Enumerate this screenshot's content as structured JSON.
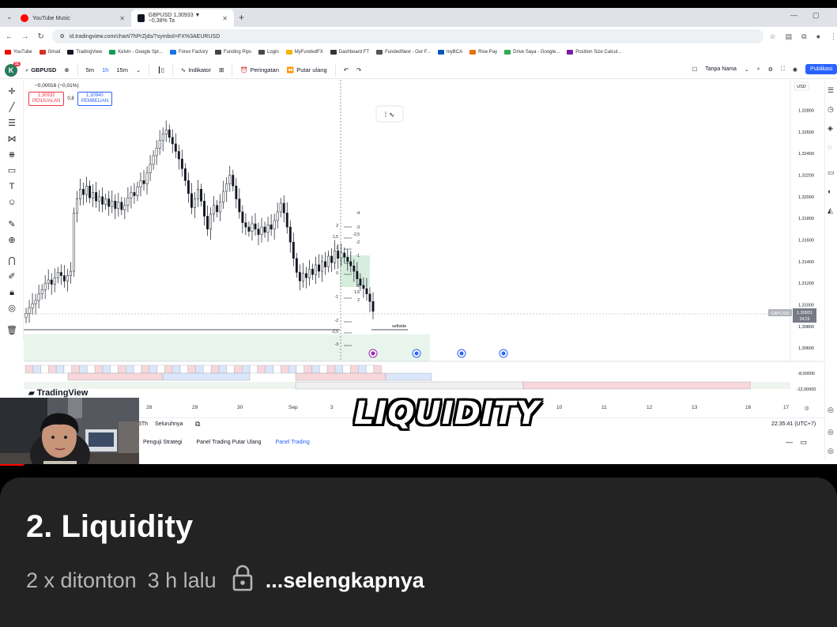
{
  "browser": {
    "tabs": [
      {
        "label": "YouTube Music",
        "color": "#ff0000"
      },
      {
        "label": "GBPUSD 1,30933 ▼ −0,38% Ta",
        "color": "#131722"
      }
    ],
    "url": "id.tradingview.com/chart/7hPrZjds/?symbol=FX%3AEURUSD",
    "bookmarks": [
      "YouTube",
      "Gmail",
      "TradingView",
      "Kelvin - Google Spr...",
      "Forex Factory",
      "Funding Pips",
      "Login",
      "MyFundedFX",
      "Dashboard FT",
      "FundedNext - Our F...",
      "myBCA",
      "Rise Pay",
      "Drive Saya - Google...",
      "Position Size Calcul..."
    ]
  },
  "tv_toolbar": {
    "logo_letter": "K",
    "logo_badge": "11",
    "symbol": "GBPUSD",
    "timeframes": [
      "5m",
      "1h",
      "15m"
    ],
    "indicator_label": "Indikator",
    "alert_label": "Peringatan",
    "replay_label": "Putar ulang",
    "layout_name": "Tanpa Nama",
    "publish_label": "Publikasi"
  },
  "ticker": {
    "change": "−0,00016 (−0,01%)",
    "sell_price": "1,30932",
    "sell_label": "PENJUALAN",
    "spread": "0,8",
    "buy_price": "1,30940",
    "buy_label": "PEMBELIAN"
  },
  "chart_data": {
    "type": "candlestick",
    "symbol": "GBPUSD",
    "currency": "USD",
    "y_ticks": [
      "1,32800",
      "1,32600",
      "1,32400",
      "1,32200",
      "1,32000",
      "1,31800",
      "1,31600",
      "1,31400",
      "1,31200",
      "1,31000",
      "1,30800",
      "1,30600"
    ],
    "y_values": [
      1.328,
      1.326,
      1.324,
      1.322,
      1.32,
      1.318,
      1.316,
      1.314,
      1.312,
      1.31,
      1.308,
      1.306
    ],
    "ylim": [
      1.3052,
      1.3298
    ],
    "current_price_label": "GBPUSD",
    "current_price": "1,30931",
    "countdown": "24:19",
    "annotation": "sellside",
    "fib_labels_left": [
      "2",
      "1,5",
      "1",
      "0",
      "-1",
      "-2",
      "-2,5",
      "-3"
    ],
    "fib_labels_right": [
      "-4",
      "-3",
      "-2,5",
      "-2",
      "-1",
      "1",
      "1,5",
      "2"
    ],
    "indicator_ticks": [
      "-8,00000",
      "-12,00000"
    ],
    "x_dates": [
      "28",
      "29",
      "30",
      "Sep",
      "3",
      "9",
      "10",
      "11",
      "12",
      "13",
      "16",
      "17"
    ],
    "candles": [
      1.3092,
      1.3097,
      1.3101,
      1.3104,
      1.311,
      1.3114,
      1.312,
      1.3123,
      1.3119,
      1.3125,
      1.313,
      1.3127,
      1.3122,
      1.3127,
      1.3131,
      1.3185,
      1.3198,
      1.3207,
      1.3202,
      1.321,
      1.3199,
      1.3204,
      1.3196,
      1.32,
      1.3193,
      1.3198,
      1.3191,
      1.3196,
      1.3189,
      1.3195,
      1.3188,
      1.3192,
      1.3199,
      1.3204,
      1.3201,
      1.3209,
      1.3215,
      1.3212,
      1.3222,
      1.323,
      1.3238,
      1.3245,
      1.3252,
      1.3258,
      1.3262,
      1.3255,
      1.3249,
      1.3242,
      1.3235,
      1.3226,
      1.3215,
      1.3203,
      1.319,
      1.3198,
      1.3207,
      1.3196,
      1.3182,
      1.317,
      1.3184,
      1.3192,
      1.3186,
      1.3195,
      1.3205,
      1.3212,
      1.322,
      1.321,
      1.3198,
      1.3186,
      1.3176,
      1.3172,
      1.3168,
      1.3175,
      1.317,
      1.3165,
      1.3172,
      1.3167,
      1.3174,
      1.317,
      1.3178,
      1.3186,
      1.3194,
      1.3185,
      1.3172,
      1.3158,
      1.3143,
      1.313,
      1.3122,
      1.3129,
      1.3125,
      1.3133,
      1.3128,
      1.3137,
      1.3131,
      1.314,
      1.3135,
      1.3145,
      1.3139,
      1.315,
      1.3143,
      1.3148,
      1.3144,
      1.314,
      1.3136,
      1.3131,
      1.3124,
      1.3118,
      1.3115,
      1.311,
      1.3103,
      1.3094
    ]
  },
  "time_bar": {
    "range_label": "5Th",
    "range_more": "Seluruhnya",
    "clock": "22:35:41 (UTC+7)"
  },
  "panels": [
    "Penguji Strategi",
    "Panel Trading Putar Ulang",
    "Panel Trading"
  ],
  "watermark": "TradingView",
  "subtitle": "LIQUIDITY",
  "video": {
    "title": "2. Liquidity",
    "views": "2 x ditonton",
    "age": "3 h lalu",
    "more": "...selengkapnya"
  }
}
